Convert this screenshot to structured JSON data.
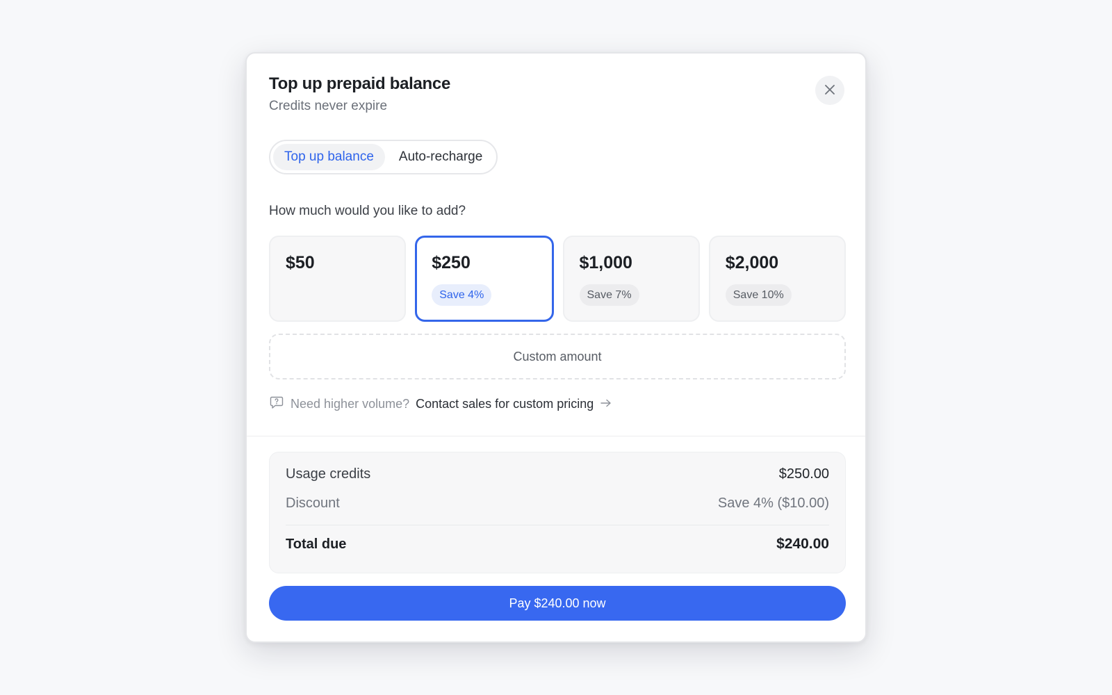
{
  "modal": {
    "title": "Top up prepaid balance",
    "subtitle": "Credits never expire",
    "close_icon": "close-icon"
  },
  "tabs": [
    {
      "label": "Top up balance",
      "active": true
    },
    {
      "label": "Auto-recharge",
      "active": false
    }
  ],
  "question": "How much would you like to add?",
  "options": [
    {
      "amount": "$50",
      "badge": "",
      "selected": false
    },
    {
      "amount": "$250",
      "badge": "Save 4%",
      "selected": true
    },
    {
      "amount": "$1,000",
      "badge": "Save 7%",
      "selected": false
    },
    {
      "amount": "$2,000",
      "badge": "Save 10%",
      "selected": false
    }
  ],
  "custom_amount_label": "Custom amount",
  "volume": {
    "icon": "chat-question-icon",
    "prompt": "Need higher volume?",
    "link_label": "Contact sales for custom pricing",
    "arrow_icon": "arrow-right-icon"
  },
  "summary": {
    "usage_label": "Usage credits",
    "usage_value": "$250.00",
    "discount_label": "Discount",
    "discount_value": "Save 4% ($10.00)",
    "total_label": "Total due",
    "total_value": "$240.00"
  },
  "pay_button_label": "Pay $240.00 now",
  "colors": {
    "accent": "#3868f0",
    "selected_border": "#3466ea",
    "background": "#f7f8fa"
  }
}
